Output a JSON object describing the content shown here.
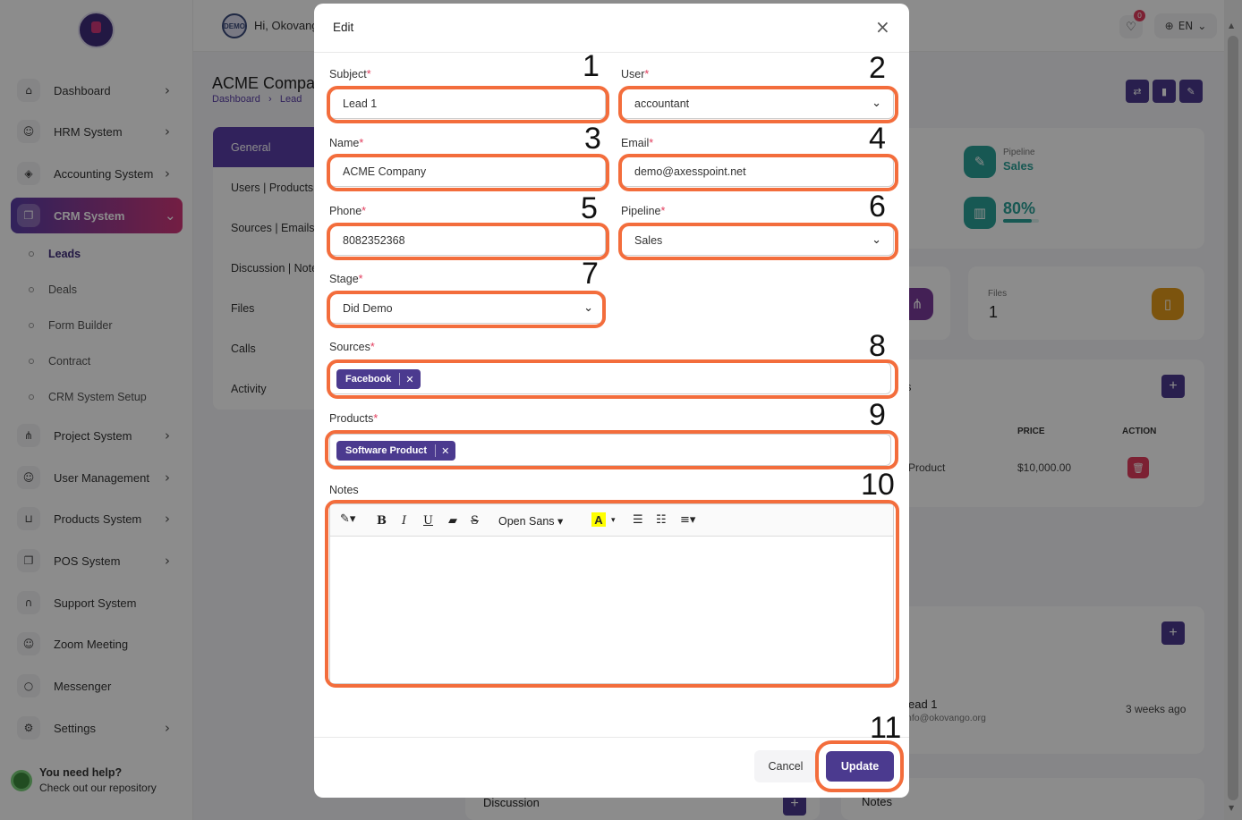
{
  "app": {
    "greeting": "Hi, Okovang",
    "notification_count": "0",
    "language": "EN",
    "demo_badge": "DEMO"
  },
  "sidebar": {
    "items": [
      {
        "label": "Dashboard",
        "icon": "home-icon",
        "chevron": "›"
      },
      {
        "label": "HRM System",
        "icon": "user-icon",
        "chevron": "›"
      },
      {
        "label": "Accounting System",
        "icon": "box-icon",
        "chevron": "›"
      },
      {
        "label": "CRM System",
        "icon": "layers-icon",
        "chevron": "⌄"
      },
      {
        "label": "Project System",
        "icon": "share-icon",
        "chevron": "›"
      },
      {
        "label": "User Management",
        "icon": "users-icon",
        "chevron": "›"
      },
      {
        "label": "Products System",
        "icon": "cart-icon",
        "chevron": "›"
      },
      {
        "label": "POS System",
        "icon": "layers-icon",
        "chevron": "›"
      },
      {
        "label": "Support System",
        "icon": "headphones-icon",
        "chevron": ""
      },
      {
        "label": "Zoom Meeting",
        "icon": "user-check-icon",
        "chevron": ""
      },
      {
        "label": "Messenger",
        "icon": "chat-icon",
        "chevron": ""
      },
      {
        "label": "Settings",
        "icon": "gear-icon",
        "chevron": "›"
      }
    ],
    "crm_sub": [
      "Leads",
      "Deals",
      "Form Builder",
      "Contract",
      "CRM System Setup"
    ],
    "help_title": "You need help?",
    "help_text": "Check out our repository"
  },
  "page": {
    "title": "ACME Compan",
    "breadcrumb": [
      "Dashboard",
      "Lead"
    ],
    "tabs": [
      "General",
      "Users | Products",
      "Sources | Emails",
      "Discussion | Note",
      "Files",
      "Calls",
      "Activity"
    ],
    "pipeline_label": "Pipeline",
    "pipeline_value": "Sales",
    "progress": "80%",
    "files_label": "Files",
    "files_count": "1",
    "products_table": {
      "col_price": "PRICE",
      "col_action": "ACTION",
      "row_name": "Product",
      "row_price": "$10,000.00"
    },
    "activity_item": "ead 1",
    "activity_email": "nfo@okovango.org",
    "activity_time": "3 weeks ago",
    "discussion_label": "Discussion",
    "notes_label": "Notes",
    "card_fragment": "s"
  },
  "modal": {
    "title": "Edit",
    "close": "×",
    "required_mark": "*",
    "subject": {
      "label": "Subject",
      "value": "Lead 1"
    },
    "user": {
      "label": "User",
      "value": "accountant"
    },
    "name": {
      "label": "Name",
      "value": "ACME Company"
    },
    "email": {
      "label": "Email",
      "value": "demo@axesspoint.net"
    },
    "phone": {
      "label": "Phone",
      "value": "8082352368"
    },
    "pipeline": {
      "label": "Pipeline",
      "value": "Sales"
    },
    "stage": {
      "label": "Stage",
      "value": "Did Demo"
    },
    "sources": {
      "label": "Sources",
      "tags": [
        "Facebook"
      ]
    },
    "products": {
      "label": "Products",
      "tags": [
        "Software Product"
      ]
    },
    "notes": {
      "label": "Notes",
      "font": "Open Sans"
    },
    "toolbar": {
      "bold": "B",
      "italic": "I",
      "underline": "U",
      "strike": "S",
      "color_letter": "A"
    },
    "cancel_label": "Cancel",
    "update_label": "Update"
  },
  "annotations": [
    "1",
    "2",
    "3",
    "4",
    "5",
    "6",
    "7",
    "8",
    "9",
    "10",
    "11"
  ],
  "colors": {
    "accent": "#4b3a8f",
    "highlight": "#f36d3c",
    "required": "#e23d5d",
    "gradient_start": "#5a3ea8",
    "gradient_end": "#d2387a"
  }
}
